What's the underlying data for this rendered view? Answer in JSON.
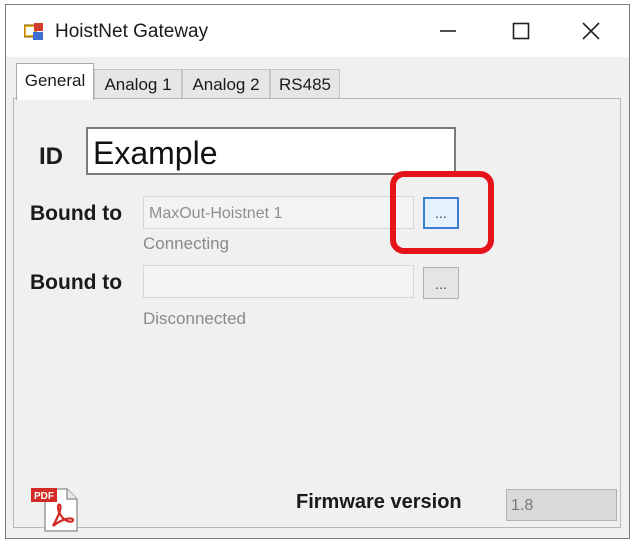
{
  "window": {
    "title": "HoistNet Gateway",
    "app_icon": "hoistnet-app-icon",
    "controls": [
      "minimize-icon",
      "maximize-icon",
      "close-icon"
    ]
  },
  "tabs": [
    {
      "label": "General",
      "active": true
    },
    {
      "label": "Analog 1",
      "active": false
    },
    {
      "label": "Analog 2",
      "active": false
    },
    {
      "label": "RS485",
      "active": false
    }
  ],
  "general": {
    "id_label": "ID",
    "id_value": "Example",
    "bindings": [
      {
        "label": "Bound to",
        "value": "MaxOut-Hoistnet 1",
        "status": "Connecting",
        "browse_label": "...",
        "highlighted": true
      },
      {
        "label": "Bound to",
        "value": "",
        "status": "Disconnected",
        "browse_label": "...",
        "highlighted": false
      }
    ],
    "firmware_label": "Firmware version",
    "firmware_value": "1.8",
    "pdf_icon": "pdf-icon"
  },
  "colors": {
    "highlight": "#e4141a",
    "focus_border": "#3a7fd5",
    "pdf_red": "#d32a25"
  }
}
